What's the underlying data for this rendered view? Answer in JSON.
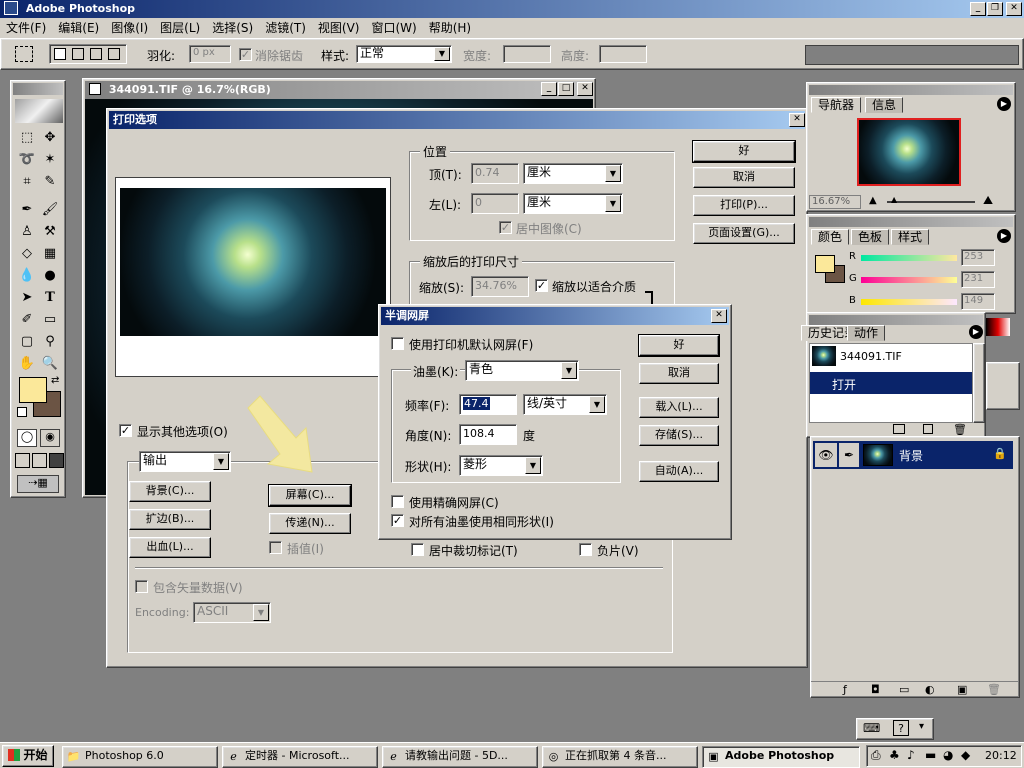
{
  "app": {
    "title": "Adobe Photoshop"
  },
  "menu": [
    "文件(F)",
    "编辑(E)",
    "图像(I)",
    "图层(L)",
    "选择(S)",
    "滤镜(T)",
    "视图(V)",
    "窗口(W)",
    "帮助(H)"
  ],
  "options": {
    "feather_label": "羽化:",
    "feather_value": "0 px",
    "antialias": "消除锯齿",
    "style_label": "样式:",
    "style_value": "正常",
    "width_label": "宽度:",
    "height_label": "高度:"
  },
  "document": {
    "title": "344091.TIF @ 16.7%(RGB)"
  },
  "print": {
    "title": "打印选项",
    "position_group": "位置",
    "top_label": "顶(T):",
    "top_value": "0.74",
    "top_unit": "厘米",
    "left_label": "左(L):",
    "left_value": "0",
    "left_unit": "厘米",
    "center_image": "居中图像(C)",
    "scaled_group": "缩放后的打印尺寸",
    "scale_label": "缩放(S):",
    "scale_value": "34.76%",
    "fit_media": "缩放以适合介质",
    "show_more": "显示其他选项(O)",
    "output_select": "输出",
    "buttons": {
      "ok": "好",
      "cancel": "取消",
      "print": "打印(P)...",
      "page_setup": "页面设置(G)..."
    },
    "opts": {
      "background": "背景(C)...",
      "border": "扩边(B)...",
      "bleed": "出血(L)...",
      "screen": "屏幕(C)...",
      "transfer": "传递(N)...",
      "interpolation": "插值(I)",
      "center_crop": "居中裁切标记(T)",
      "negative": "负片(V)",
      "include_vector": "包含矢量数据(V)",
      "encoding_label": "Encoding:",
      "encoding_value": "ASCII"
    }
  },
  "halftone": {
    "title": "半调网屏",
    "use_printer": "使用打印机默认网屏(F)",
    "ink_label": "油墨(K):",
    "ink_value": "青色",
    "freq_label": "频率(F):",
    "freq_value": "47.4",
    "freq_unit": "线/英寸",
    "angle_label": "角度(N):",
    "angle_value": "108.4",
    "angle_unit": "度",
    "shape_label": "形状(H):",
    "shape_value": "菱形",
    "accurate": "使用精确网屏(C)",
    "same_shape": "对所有油墨使用相同形状(I)",
    "buttons": {
      "ok": "好",
      "cancel": "取消",
      "load": "载入(L)...",
      "save": "存储(S)...",
      "auto": "自动(A)..."
    }
  },
  "navigator": {
    "tabs": [
      "导航器",
      "信息"
    ],
    "zoom": "16.67%"
  },
  "color": {
    "tabs": [
      "颜色",
      "色板",
      "样式"
    ],
    "r_label": "R",
    "r": "253",
    "g_label": "G",
    "g": "231",
    "b_label": "B",
    "b": "149"
  },
  "history": {
    "tabs": [
      "历史记录",
      "动作"
    ],
    "snapshot": "344091.TIF",
    "open": "打开"
  },
  "layers": {
    "name": "背景"
  },
  "taskbar": {
    "start": "开始",
    "items": [
      "Photoshop 6.0",
      "定时器 - Microsoft...",
      "请教输出问题 - 5D...",
      "正在抓取第 4 条音...",
      "Adobe Photoshop"
    ],
    "time": "20:12"
  },
  "colors": {
    "accent": "#0a246a",
    "foreground": "#fbe89a",
    "background": "#6b5444"
  }
}
